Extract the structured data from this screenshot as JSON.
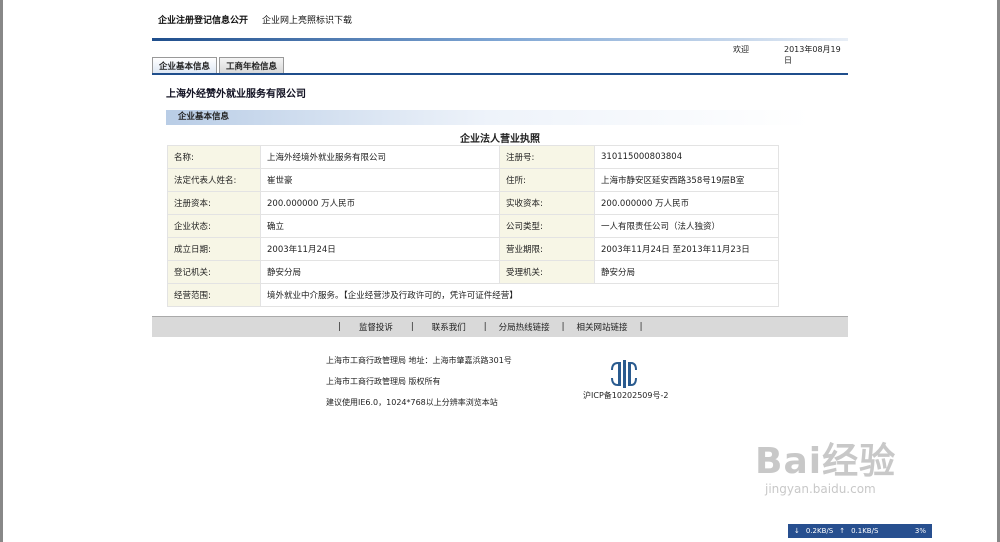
{
  "header": {
    "nav_registration": "企业注册登记信息公开",
    "nav_download": "企业网上亮照标识下载",
    "welcome": "欢迎",
    "date": "2013年08月19日"
  },
  "tabs": [
    {
      "label": "企业基本信息"
    },
    {
      "label": "工商年检信息"
    }
  ],
  "company_name": "上海外经赞外就业服务有限公司",
  "section_title": "企业基本信息",
  "license_title": "企业法人营业执照",
  "rows": [
    {
      "l1": "名称:",
      "v1": "上海外经境外就业服务有限公司",
      "l2": "注册号:",
      "v2": "310115000803804"
    },
    {
      "l1": "法定代表人姓名:",
      "v1": "崔世豪",
      "l2": "住所:",
      "v2": "上海市静安区延安西路358号19层B室"
    },
    {
      "l1": "注册资本:",
      "v1": "200.000000  万人民币",
      "l2": "实收资本:",
      "v2": "200.000000  万人民币"
    },
    {
      "l1": "企业状态:",
      "v1": "确立",
      "l2": "公司类型:",
      "v2": "一人有限责任公司（法人独资）"
    },
    {
      "l1": "成立日期:",
      "v1": "2003年11月24日",
      "l2": "营业期限:",
      "v2": "2003年11月24日 至2013年11月23日"
    },
    {
      "l1": "登记机关:",
      "v1": "静安分局",
      "l2": "受理机关:",
      "v2": "静安分局"
    },
    {
      "l1": "经营范围:",
      "v1": "境外就业中介服务。【企业经营涉及行政许可的，凭许可证件经营】"
    }
  ],
  "footer_nav": [
    {
      "label": "监督投诉"
    },
    {
      "label": "联系我们"
    },
    {
      "label": "分局热线链接"
    },
    {
      "label": "相关网站链接"
    }
  ],
  "footer": {
    "address": "上海市工商行政管理局 地址：上海市肇嘉浜路301号",
    "copyright": "上海市工商行政管理局 版权所有",
    "recommend": "建议使用IE6.0，1024*768以上分辨率浏览本站",
    "icp": "沪ICP备10202509号-2"
  },
  "watermark": {
    "big": "Bai经验",
    "small": "jingyan.baidu.com"
  },
  "speedbar": {
    "down": "0.2KB/S",
    "up": "0.1KB/S",
    "percent": "3%"
  }
}
